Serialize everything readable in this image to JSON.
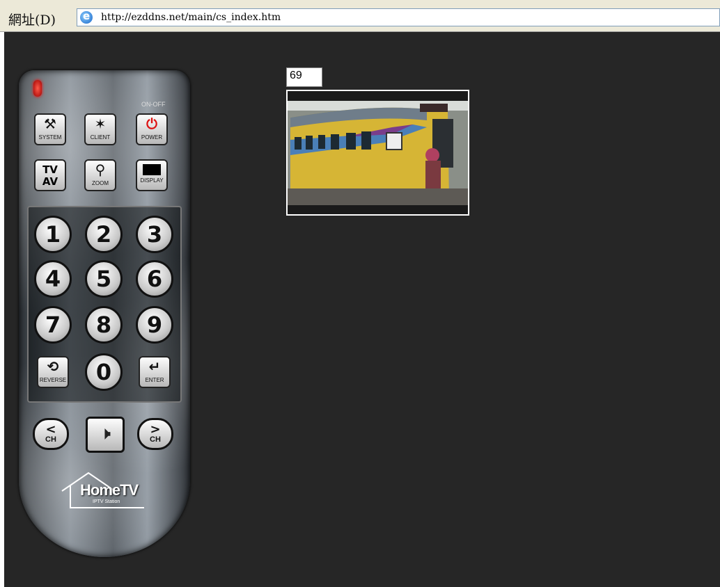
{
  "address_bar": {
    "label": "網址(D)",
    "url": "http://ezddns.net/main/cs_index.htm"
  },
  "remote": {
    "on_off_label": "ON-OFF",
    "function_buttons": [
      {
        "label": "SYSTEM",
        "icon": "tools-icon"
      },
      {
        "label": "CLIENT",
        "icon": "client-icon"
      },
      {
        "label": "POWER",
        "icon": "power-icon"
      },
      {
        "label": "",
        "icon": "tv-av-icon"
      },
      {
        "label": "ZOOM",
        "icon": "zoom-icon"
      },
      {
        "label": "DISPLAY",
        "icon": "display-icon"
      }
    ],
    "tv_av_top": "TV",
    "tv_av_bottom": "AV",
    "digits": [
      "1",
      "2",
      "3",
      "4",
      "5",
      "6",
      "7",
      "8",
      "9",
      "0"
    ],
    "reverse_label": "REVERSE",
    "enter_label": "ENTER",
    "ch_down": "CH",
    "ch_up": "CH",
    "logo_text": "HomeTV",
    "logo_sub": "IPTV Station"
  },
  "channel_number": "69",
  "colors": {
    "background": "#262626",
    "address_bar": "#ece9d8",
    "power_red": "#d11111"
  }
}
